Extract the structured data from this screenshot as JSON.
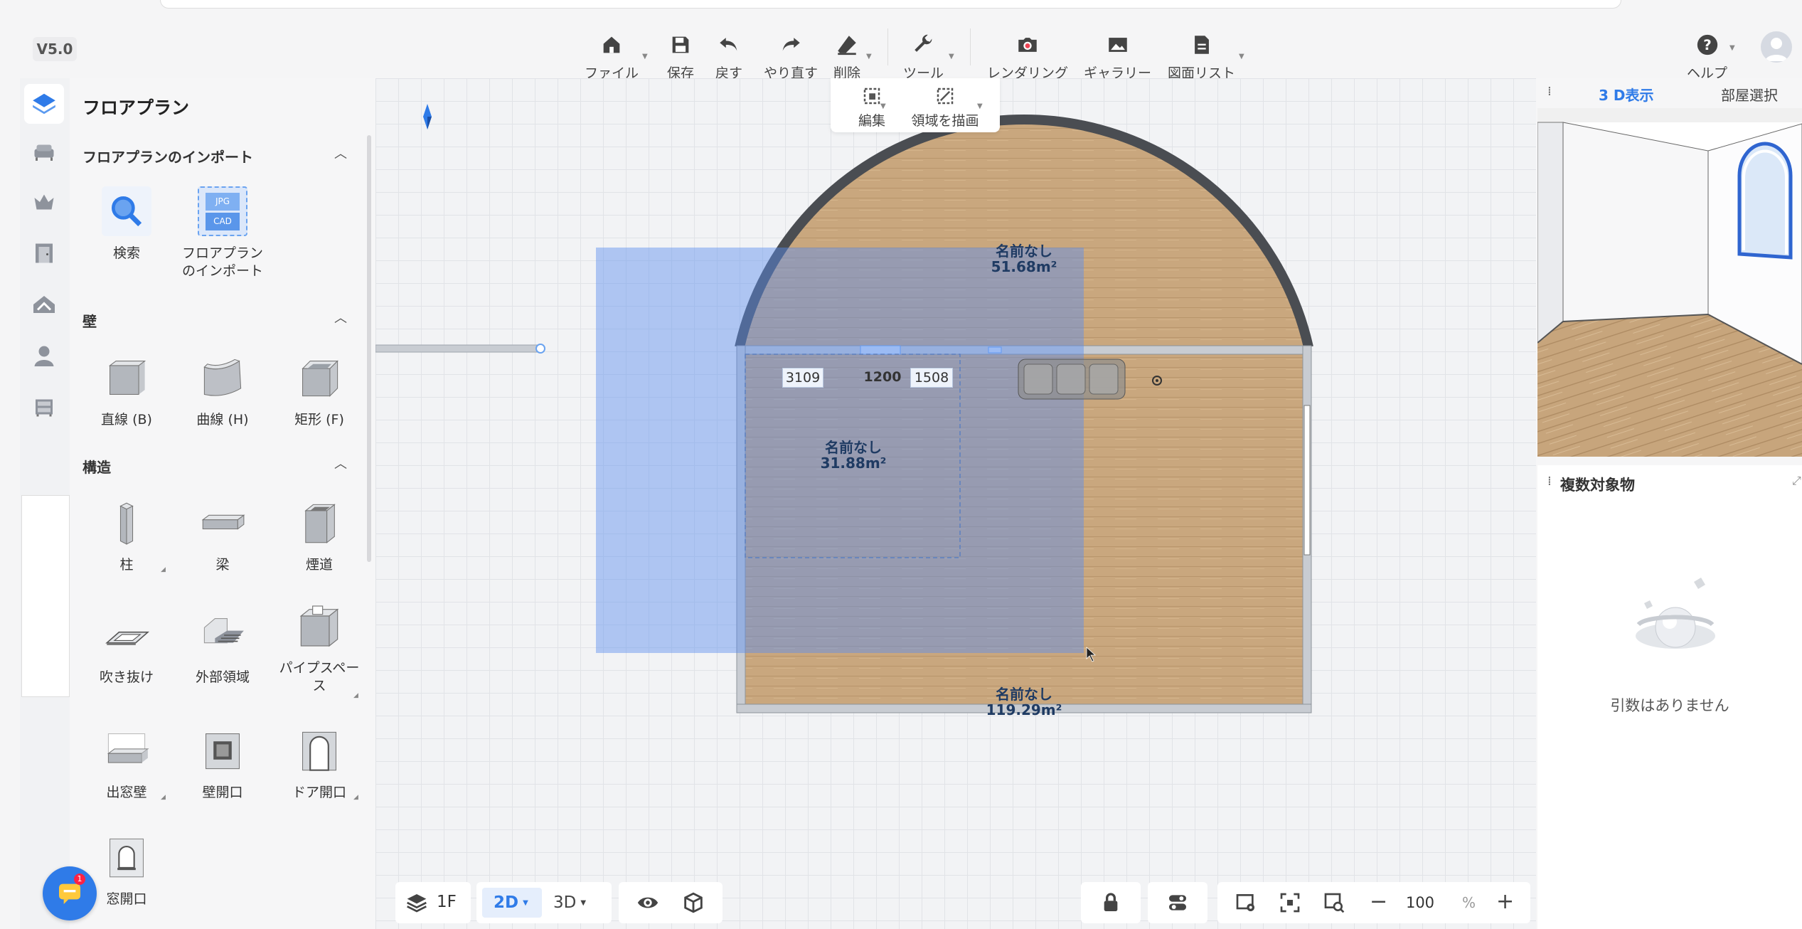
{
  "version": "V5.0",
  "toolbar": {
    "file": "ファイル",
    "save": "保存",
    "undo": "戻す",
    "redo": "やり直す",
    "delete": "削除",
    "tools": "ツール",
    "rendering": "レンダリング",
    "gallery": "ギャラリー",
    "drawing_list": "図面リスト",
    "help": "ヘルプ"
  },
  "subtoolbar": {
    "edit": "編集",
    "draw_area": "領域を描画"
  },
  "panel": {
    "title": "フロアプラン",
    "sections": [
      {
        "title": "フロアプランのインポート",
        "items": [
          "検索",
          "フロアプラン\nのインポート"
        ]
      },
      {
        "title": "壁",
        "items": [
          "直線 (B)",
          "曲線 (H)",
          "矩形 (F)"
        ]
      },
      {
        "title": "構造",
        "items": [
          "柱",
          "梁",
          "煙道",
          "吹き抜け",
          "外部領域",
          "パイプスペース",
          "出窓壁",
          "壁開口",
          "ドア開口",
          "窓開口"
        ]
      }
    ],
    "import_labels": {
      "search": "検索",
      "import_l1": "フロアプラン",
      "import_l2": "のインポート",
      "jpg": "JPG",
      "cad": "CAD"
    },
    "pipe_l1": "パイプスペー",
    "pipe_l2": "ス"
  },
  "canvas": {
    "rooms": [
      {
        "name": "名前なし",
        "area": "51.68m²"
      },
      {
        "name": "名前なし",
        "area": "31.88m²"
      },
      {
        "name": "名前なし",
        "area": "119.29m²"
      }
    ],
    "dimensions": [
      "3109",
      "1200",
      "1508"
    ]
  },
  "right_panel": {
    "tab_3d": "3 D表示",
    "tab_room": "部屋選択",
    "multi_title": "複数対象物",
    "empty_text": "引数はありません"
  },
  "bottom_bar": {
    "floor": "1F",
    "view_2d": "2D",
    "view_3d": "3D",
    "zoom": "100",
    "zoom_unit": "%"
  },
  "chat_badge": "1",
  "colors": {
    "accent": "#2f7be8",
    "floor_wood": "#c9a77e",
    "selection": "#8aaef0"
  }
}
